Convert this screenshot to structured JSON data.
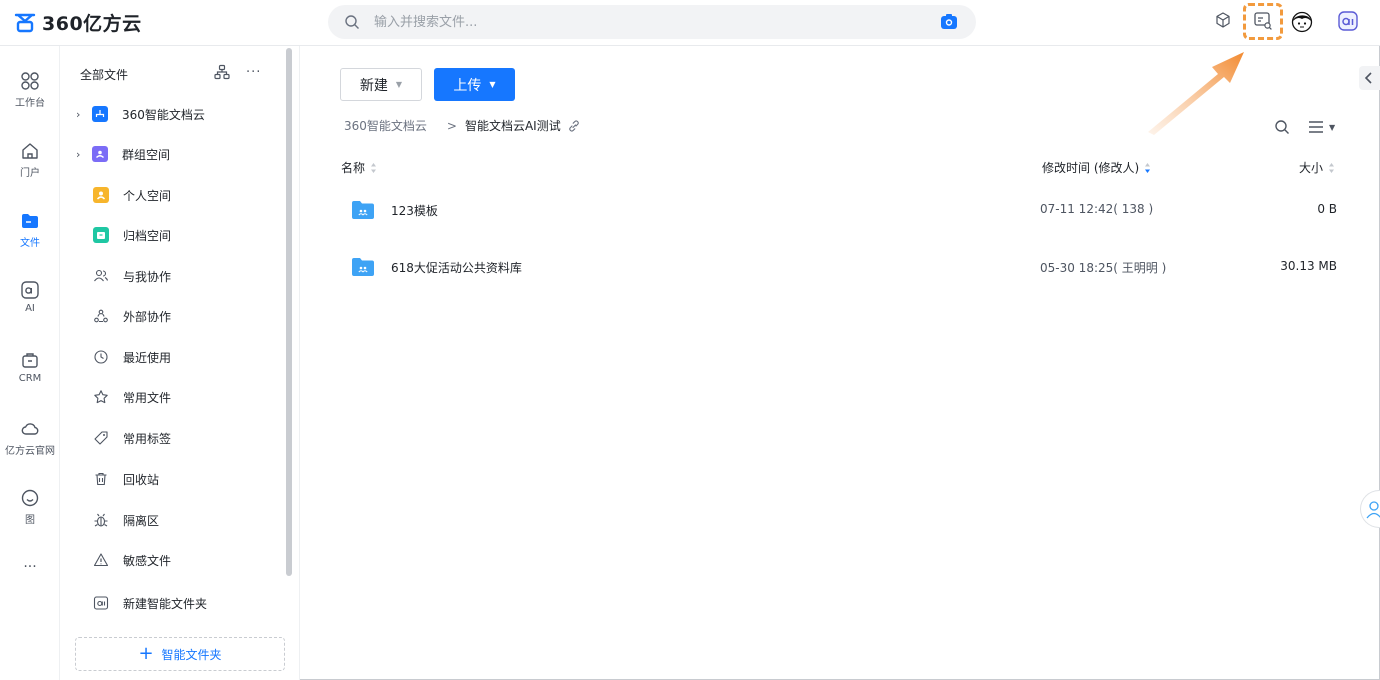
{
  "brand": {
    "logo_text": "360亿方云"
  },
  "search": {
    "placeholder": "输入并搜索文件..."
  },
  "rail": {
    "items": [
      {
        "label": "工作台"
      },
      {
        "label": "门户"
      },
      {
        "label": "文件"
      },
      {
        "label": "AI"
      },
      {
        "label": "CRM"
      },
      {
        "label": "亿方云官网"
      },
      {
        "label": "图"
      },
      {
        "label": "···"
      }
    ]
  },
  "sidebar": {
    "title": "全部文件",
    "more": "···",
    "items": [
      {
        "label": "360智能文档云"
      },
      {
        "label": "群组空间"
      },
      {
        "label": "个人空间"
      },
      {
        "label": "归档空间"
      },
      {
        "label": "与我协作"
      },
      {
        "label": "外部协作"
      },
      {
        "label": "最近使用"
      },
      {
        "label": "常用文件"
      },
      {
        "label": "常用标签"
      },
      {
        "label": "回收站"
      },
      {
        "label": "隔离区"
      },
      {
        "label": "敏感文件"
      },
      {
        "label": "新建智能文件夹"
      }
    ],
    "smart_folder_button": "智能文件夹",
    "smart_folder_plus": "+"
  },
  "toolbar": {
    "new_label": "新建",
    "upload_label": "上传",
    "dropdown_caret": "▼"
  },
  "breadcrumb": {
    "root": "360智能文档云",
    "separator": ">",
    "current": "智能文档云AI测试"
  },
  "table": {
    "headers": {
      "name": "名称",
      "modified": "修改时间 (修改人)",
      "size": "大小"
    },
    "rows": [
      {
        "name": "123模板",
        "modified": "07-11 12:42( 138 )",
        "size": "0 B"
      },
      {
        "name": "618大促活动公共资料库",
        "modified": "05-30 18:25( 王明明 )",
        "size": "30.13 MB"
      }
    ]
  },
  "colors": {
    "accent": "#1677ff",
    "highlight": "#f29a3d",
    "folder": "#3ea3f5"
  }
}
